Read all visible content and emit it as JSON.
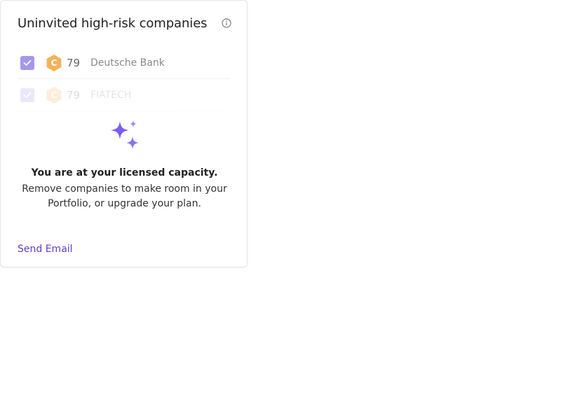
{
  "card": {
    "title": "Uninvited high-risk companies",
    "companies": [
      {
        "grade": "C",
        "score": "79",
        "name": "Deutsche Bank",
        "checked": true
      },
      {
        "grade": "C",
        "score": "79",
        "name": "FIATECH",
        "checked": true
      }
    ],
    "message": {
      "title": "You are at your licensed capacity.",
      "body": "Remove companies to make room in your Portfolio, or upgrade your plan."
    },
    "send_email_label": "Send Email"
  },
  "colors": {
    "accent": "#5b3ccc",
    "checkbox": "#a596ee",
    "grade_c": "#f2b35a",
    "sparkle": "#7b5cf0"
  },
  "icons": {
    "info": "info-icon",
    "check": "check-icon",
    "sparkles": "sparkles-icon"
  }
}
